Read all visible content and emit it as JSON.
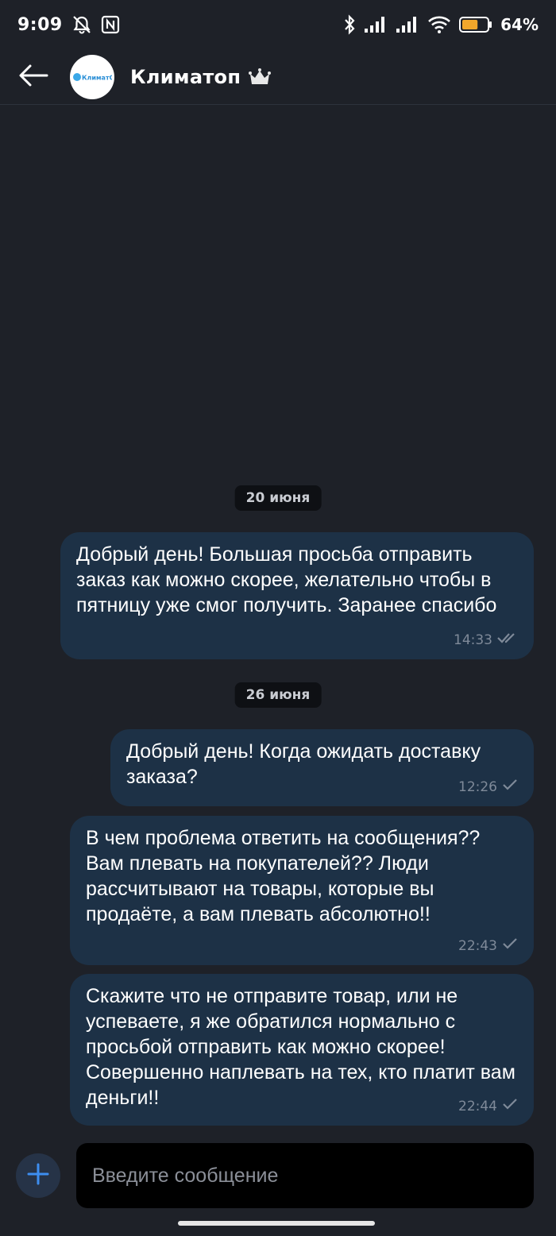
{
  "status_bar": {
    "time": "9:09",
    "battery_percent": "64%",
    "battery_level": 0.64,
    "icons": [
      "alarm-off-icon",
      "nfc-icon",
      "bluetooth-icon",
      "signal-icon",
      "signal-icon",
      "wifi-icon",
      "battery-icon"
    ]
  },
  "header": {
    "title": "Климатоп",
    "avatar_logo_text": "КлиматОК",
    "back_icon": "arrow-left-icon",
    "badge_icon": "crown-icon"
  },
  "messages": [
    {
      "date_label": "20 июня"
    },
    {
      "text": "Добрый день! Большая просьба отправить заказ как можно скорее, желательно чтобы в пятницу уже смог получить. Заранее спасибо",
      "time": "14:33",
      "status": "read"
    },
    {
      "date_label": "26 июня"
    },
    {
      "text": "Добрый день! Когда ожидать доставку заказа?",
      "time": "12:26",
      "status": "sent"
    },
    {
      "text": "В чем проблема ответить на сообщения?? Вам плевать на покупателей?? Люди рассчитывают на товары, которые вы продаёте, а вам плевать абсолютно!!",
      "time": "22:43",
      "status": "sent"
    },
    {
      "text": "Скажите что не отправите товар, или не успеваете, я же обратился нормально с просьбой отправить как можно скорее! Совершенно наплевать на тех, кто платит вам деньги!!",
      "time": "22:44",
      "status": "sent"
    }
  ],
  "composer": {
    "placeholder": "Введите сообщение",
    "attach_icon": "plus-icon"
  },
  "colors": {
    "background": "#1e2128",
    "bubble_outgoing": "#1d3146",
    "accent": "#3d8ef0",
    "battery": "#f2a72b"
  }
}
